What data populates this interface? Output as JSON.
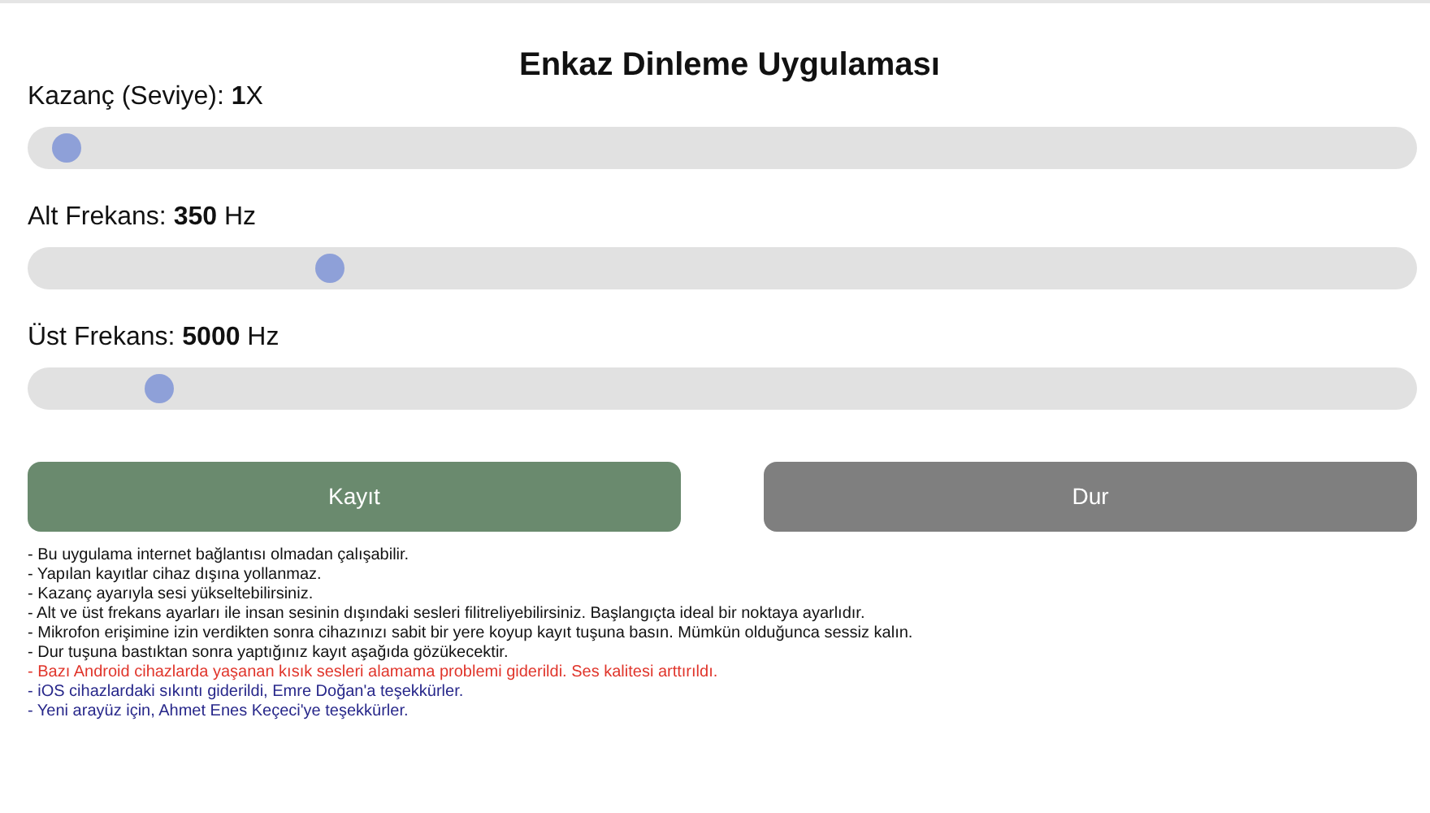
{
  "title": "Enkaz Dinleme Uygulaması",
  "sliders": [
    {
      "label": "Kazanç (Seviye): **1**X",
      "level": 0.008
    },
    {
      "label": "Alt Frekans: **350** Hz",
      "level": 0.206
    },
    {
      "label": "Üst Frekans: **5000** Hz",
      "level": 0.078
    }
  ],
  "buttons": [
    {
      "label": "Kayıt",
      "kind": "record"
    },
    {
      "label": "Dur",
      "kind": "stop"
    }
  ],
  "notes": [
    {
      "text": "- Bu uygulama internet bağlantısı olmadan çalışabilir.",
      "color": "#111111"
    },
    {
      "text": "- Yapılan kayıtlar cihaz dışına yollanmaz.",
      "color": "#111111"
    },
    {
      "text": "- Kazanç ayarıyla sesi yükseltebilirsiniz.",
      "color": "#111111"
    },
    {
      "text": "- Alt ve üst frekans ayarları ile insan sesinin dışındaki sesleri filitreliyebilirsiniz. Başlangıçta ideal bir noktaya ayarlıdır.",
      "color": "#111111"
    },
    {
      "text": "- Mikrofon erişimine izin verdikten sonra cihazınızı sabit bir yere koyup kayıt tuşuna basın. Mümkün olduğunca sessiz kalın.",
      "color": "#111111"
    },
    {
      "text": "- Dur tuşuna bastıktan sonra yaptığınız kayıt aşağıda gözükecektir.",
      "color": "#111111"
    },
    {
      "text": "- Bazı Android cihazlarda yaşanan kısık sesleri alamama problemi giderildi. Ses kalitesi arttırıldı.",
      "color": "#e0352b"
    },
    {
      "text": "- iOS cihazlardaki sıkıntı giderildi, Emre Doğan'a teşekkürler.",
      "color": "#27278a"
    },
    {
      "text": "- Yeni arayüz için, Ahmet Enes Keçeci'ye teşekkürler.",
      "color": "#27278a"
    }
  ]
}
